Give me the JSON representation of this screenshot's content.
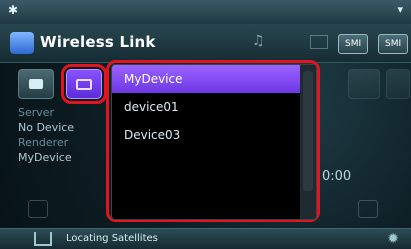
{
  "window": {
    "title": "Wireless Link"
  },
  "titlebar": {
    "smi_label_1": "SMI",
    "smi_label_2": "SMI"
  },
  "left_panel": {
    "server_label": "Server",
    "server_value": "No Device",
    "renderer_label": "Renderer",
    "renderer_value": "MyDevice"
  },
  "player": {
    "time": "0:00"
  },
  "dropdown": {
    "items": [
      {
        "label": "MyDevice",
        "selected": true
      },
      {
        "label": "device01",
        "selected": false
      },
      {
        "label": "Device03",
        "selected": false
      }
    ]
  },
  "bottombar": {
    "status": "Locating Satellites"
  },
  "icons": {
    "status_left": "bluetooth-icon",
    "app": "wireless-link-icon",
    "title_music": "music-note-icon",
    "tb1": "speaker-icon",
    "tb2": "monitor-icon",
    "bottom_left": "house-icon",
    "bottom_right": "gear-icon"
  },
  "colors": {
    "accent_purple": "#7a45f0",
    "highlight_red": "#e4141e",
    "background": "#0d1e24"
  }
}
